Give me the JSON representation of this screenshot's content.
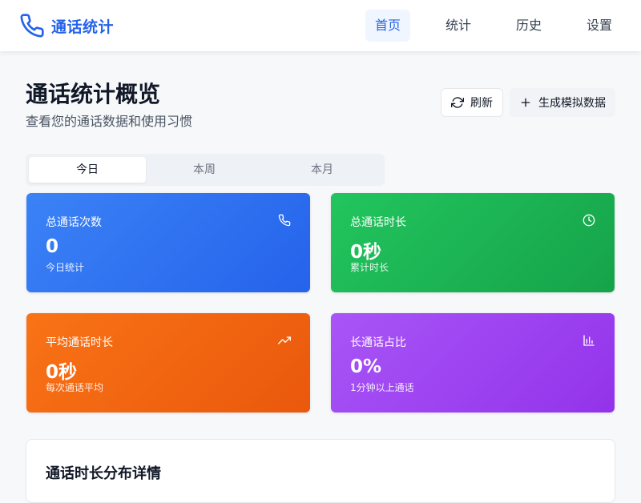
{
  "nav": {
    "brand": "通话统计",
    "brand_icon": "phone-icon",
    "items": [
      {
        "label": "首页",
        "active": true
      },
      {
        "label": "统计",
        "active": false
      },
      {
        "label": "历史",
        "active": false
      },
      {
        "label": "设置",
        "active": false
      }
    ]
  },
  "header": {
    "title": "通话统计概览",
    "subtitle": "查看您的通话数据和使用习惯",
    "refresh_label": "刷新",
    "generate_label": "生成模拟数据"
  },
  "tabs": [
    {
      "label": "今日",
      "active": true
    },
    {
      "label": "本周",
      "active": false
    },
    {
      "label": "本月",
      "active": false
    }
  ],
  "cards": [
    {
      "label": "总通话次数",
      "value": "0",
      "note": "今日统计",
      "icon": "phone-icon",
      "color": "#3b82f6"
    },
    {
      "label": "总通话时长",
      "value": "0秒",
      "note": "累计时长",
      "icon": "clock-icon",
      "color": "#22c55e"
    },
    {
      "label": "平均通话时长",
      "value": "0秒",
      "note": "每次通话平均",
      "icon": "trending-up-icon",
      "color": "#f97316"
    },
    {
      "label": "长通话占比",
      "value": "0%",
      "note": "1分钟以上通话",
      "icon": "bar-chart-icon",
      "color": "#a855f7"
    }
  ],
  "panel": {
    "title": "通话时长分布详情"
  },
  "colors": {
    "accent": "#2563eb",
    "background": "#f7f8fa"
  }
}
